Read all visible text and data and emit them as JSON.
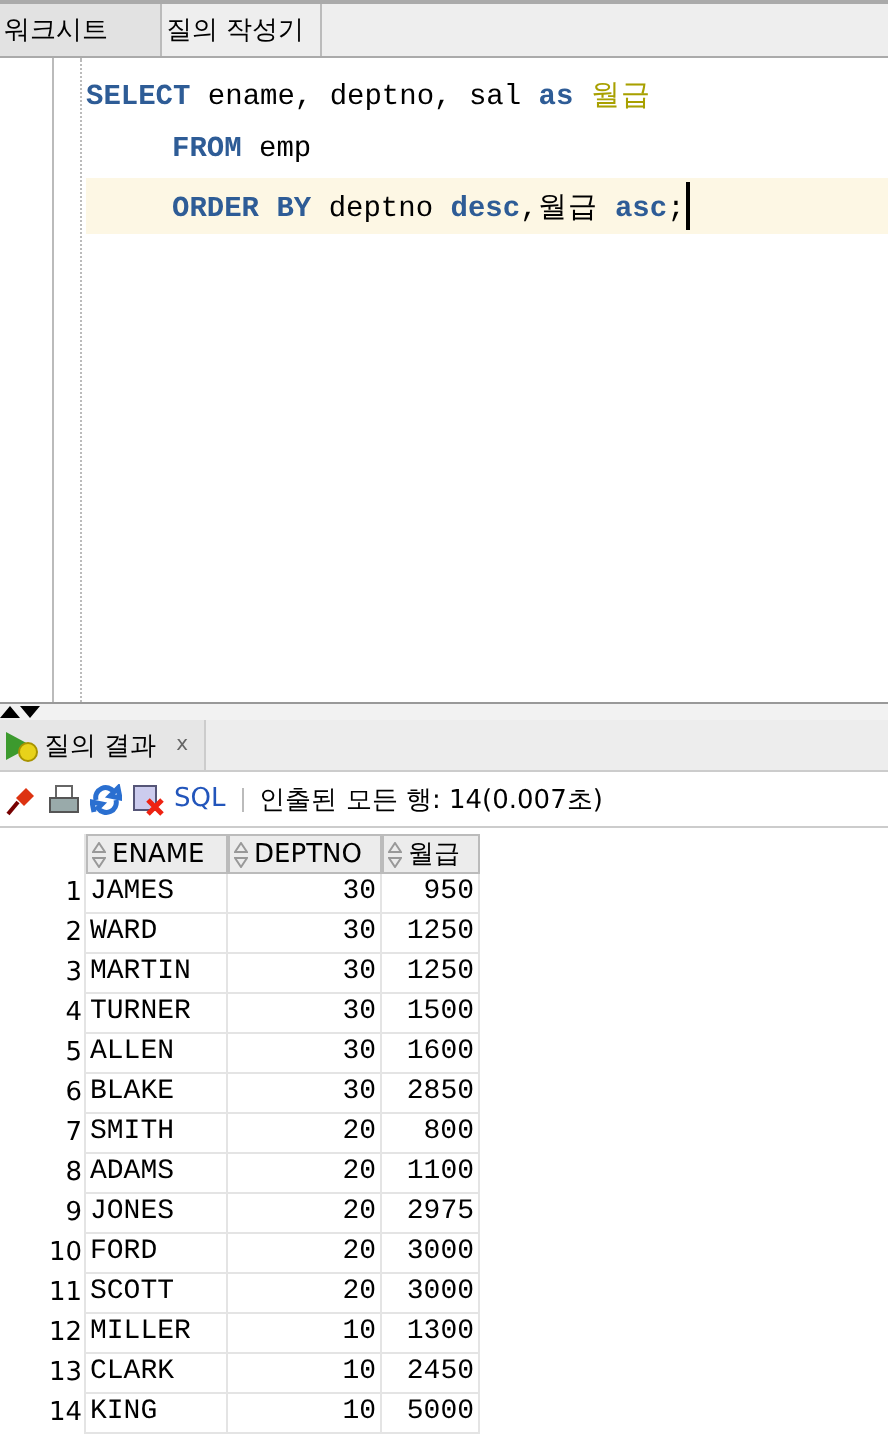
{
  "editor_tabs": [
    {
      "label": "워크시트",
      "selected": true
    },
    {
      "label": "질의 작성기",
      "selected": false
    }
  ],
  "code_lines": [
    {
      "current": false,
      "indented": false,
      "tokens": [
        {
          "text": "SELECT",
          "kind": "keyword"
        },
        {
          "text": " ename, deptno, sal ",
          "kind": "plain"
        },
        {
          "text": "as",
          "kind": "keyword"
        },
        {
          "text": " 월급",
          "kind": "alias"
        }
      ]
    },
    {
      "current": false,
      "indented": true,
      "tokens": [
        {
          "text": "FROM",
          "kind": "keyword"
        },
        {
          "text": " emp",
          "kind": "plain"
        }
      ]
    },
    {
      "current": true,
      "indented": true,
      "tokens": [
        {
          "text": "ORDER BY",
          "kind": "keyword"
        },
        {
          "text": " deptno ",
          "kind": "plain"
        },
        {
          "text": "desc",
          "kind": "keyword"
        },
        {
          "text": ",월급 ",
          "kind": "plain"
        },
        {
          "text": "asc",
          "kind": "keyword"
        },
        {
          "text": ";",
          "kind": "plain"
        }
      ]
    }
  ],
  "result_tab": {
    "label": "질의 결과",
    "close": "x"
  },
  "toolbar": {
    "sql_link": "SQL",
    "status": "인출된 모든 행: 14(0.007초)"
  },
  "table": {
    "columns": [
      "",
      "ENAME",
      "DEPTNO",
      "월급"
    ],
    "rows": [
      [
        "1",
        "JAMES",
        "30",
        "950"
      ],
      [
        "2",
        "WARD",
        "30",
        "1250"
      ],
      [
        "3",
        "MARTIN",
        "30",
        "1250"
      ],
      [
        "4",
        "TURNER",
        "30",
        "1500"
      ],
      [
        "5",
        "ALLEN",
        "30",
        "1600"
      ],
      [
        "6",
        "BLAKE",
        "30",
        "2850"
      ],
      [
        "7",
        "SMITH",
        "20",
        "800"
      ],
      [
        "8",
        "ADAMS",
        "20",
        "1100"
      ],
      [
        "9",
        "JONES",
        "20",
        "2975"
      ],
      [
        "10",
        "FORD",
        "20",
        "3000"
      ],
      [
        "11",
        "SCOTT",
        "20",
        "3000"
      ],
      [
        "12",
        "MILLER",
        "10",
        "1300"
      ],
      [
        "13",
        "CLARK",
        "10",
        "2450"
      ],
      [
        "14",
        "KING",
        "10",
        "5000"
      ]
    ]
  }
}
